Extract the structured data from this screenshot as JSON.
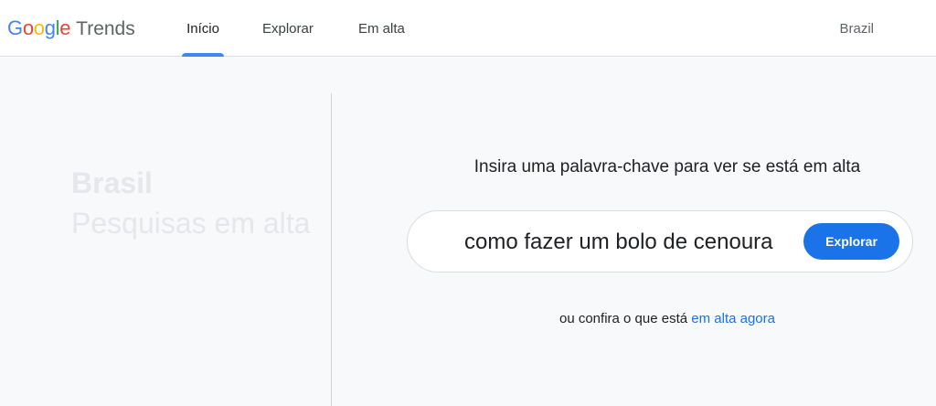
{
  "header": {
    "logo": {
      "letters": [
        "G",
        "o",
        "o",
        "g",
        "l",
        "e"
      ],
      "letter_colors": [
        "#4285f4",
        "#ea4335",
        "#fbbc05",
        "#4285f4",
        "#34a853",
        "#ea4335"
      ],
      "product": "Trends"
    },
    "nav": [
      {
        "label": "Início",
        "active": true
      },
      {
        "label": "Explorar",
        "active": false
      },
      {
        "label": "Em alta",
        "active": false
      }
    ],
    "region": "Brazil"
  },
  "left_panel": {
    "country": "Brasil",
    "subtitle": "Pesquisas em alta"
  },
  "search": {
    "prompt": "Insira uma palavra-chave para ver se está em alta",
    "value": "como fazer um bolo de cenoura",
    "button_label": "Explorar"
  },
  "trending": {
    "prefix": "ou confira o que está",
    "link_label": "em alta agora"
  },
  "colors": {
    "accent": "#1a73e8",
    "nav_underline": "#4285f4"
  }
}
